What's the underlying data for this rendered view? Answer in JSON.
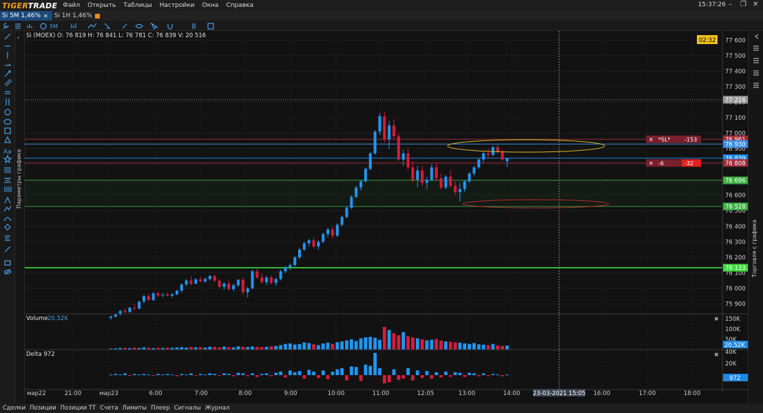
{
  "app": {
    "logo_a": "TIGER",
    "logo_b": "TRADE",
    "clock": "15:37:26"
  },
  "menu": [
    {
      "label": "Файл"
    },
    {
      "label": "Открыть"
    },
    {
      "label": "Таблицы"
    },
    {
      "label": "Настройки"
    },
    {
      "label": "Окна"
    },
    {
      "label": "Справка"
    }
  ],
  "tabs": [
    {
      "label": "Si 5M  1,46%",
      "active": true,
      "color": "#3a8ee6"
    },
    {
      "label": "Si 1H  1,46%",
      "active": false,
      "color": "#f08a20"
    }
  ],
  "toolbar": {
    "timeframe": "5M"
  },
  "sidebars": {
    "left": "Параметры графика",
    "right": "Торговля с графика"
  },
  "bottom_tabs": [
    {
      "label": "Сделки"
    },
    {
      "label": "Позиции"
    },
    {
      "label": "Позиции ТТ"
    },
    {
      "label": "Счета"
    },
    {
      "label": "Лимиты"
    },
    {
      "label": "Плеер"
    },
    {
      "label": "Сигналы"
    },
    {
      "label": "Журнал"
    }
  ],
  "chart_data": [
    {
      "type": "candlestick",
      "instrument_line": "Si (MOEX) O: 76 819  H: 76 841  L: 76 781  C: 76 839  V: 20 516",
      "timer": "02:32",
      "y_ticks": [
        "77 600",
        "77 500",
        "77 400",
        "77 300",
        "77 200",
        "77 100",
        "77 000",
        "76 900",
        "76 800",
        "76 700",
        "76 600",
        "76 500",
        "76 400",
        "76 300",
        "76 200",
        "76 100",
        "76 000",
        "75 900"
      ],
      "y_range": [
        75840,
        77650
      ],
      "levels": [
        {
          "label": "77 216",
          "value": 77216,
          "color": "#9a9a9a",
          "style": "dotted"
        },
        {
          "label": "76 961",
          "value": 76961,
          "color": "#a02a3a",
          "style": "solid"
        },
        {
          "label": "76 930",
          "value": 76930,
          "color": "#3a8ee6",
          "style": "solid"
        },
        {
          "label": "76 839",
          "value": 76839,
          "color": "#1e88e5",
          "style": "solid"
        },
        {
          "label": "76 808",
          "value": 76808,
          "color": "#a02a3a",
          "style": "solid"
        },
        {
          "label": "76 696",
          "value": 76696,
          "color": "#3cb043",
          "style": "solid"
        },
        {
          "label": "76 528",
          "value": 76528,
          "color": "#3cb043",
          "style": "solid"
        },
        {
          "label": "76 133",
          "value": 76133,
          "color": "#3cdc3c",
          "style": "solid"
        }
      ],
      "orders": [
        {
          "label": "*SL*",
          "qty": "-153",
          "value": 76961
        },
        {
          "label": "-6",
          "qty": "-32",
          "value": 76808
        }
      ],
      "x_ticks": [
        "мар22",
        "21:00",
        "мар23",
        "6:00",
        "7:00",
        "8:00",
        "9:00",
        "10:00",
        "11:00",
        "12:05",
        "13:00",
        "14:00",
        "23-03-2021 15:05",
        "16:00",
        "17:00",
        "18:00"
      ],
      "candles": [
        [
          75810,
          75825,
          75795,
          75818
        ],
        [
          75818,
          75840,
          75810,
          75832
        ],
        [
          75832,
          75860,
          75825,
          75855
        ],
        [
          75855,
          75870,
          75840,
          75848
        ],
        [
          75848,
          75880,
          75842,
          75875
        ],
        [
          75875,
          75900,
          75860,
          75870
        ],
        [
          75870,
          75920,
          75865,
          75915
        ],
        [
          75915,
          75960,
          75905,
          75950
        ],
        [
          75950,
          75965,
          75920,
          75925
        ],
        [
          75925,
          75975,
          75918,
          75968
        ],
        [
          75968,
          75980,
          75945,
          75955
        ],
        [
          75955,
          75970,
          75940,
          75960
        ],
        [
          75960,
          75975,
          75948,
          75952
        ],
        [
          75952,
          75970,
          75940,
          75962
        ],
        [
          75962,
          75990,
          75955,
          75985
        ],
        [
          75985,
          76030,
          75975,
          76025
        ],
        [
          76025,
          76060,
          76015,
          76050
        ],
        [
          76050,
          76080,
          76020,
          76030
        ],
        [
          76030,
          76065,
          76025,
          76058
        ],
        [
          76058,
          76075,
          76040,
          76045
        ],
        [
          76045,
          76070,
          76035,
          76060
        ],
        [
          76060,
          76085,
          76050,
          76080
        ],
        [
          76080,
          76090,
          76040,
          76050
        ],
        [
          76050,
          76060,
          76000,
          76010
        ],
        [
          76010,
          76040,
          75990,
          76030
        ],
        [
          76030,
          76050,
          75985,
          75995
        ],
        [
          75995,
          76030,
          75980,
          76020
        ],
        [
          76020,
          76060,
          76010,
          76055
        ],
        [
          76055,
          76070,
          75960,
          75975
        ],
        [
          75975,
          76010,
          75940,
          76000
        ],
        [
          76000,
          76120,
          75995,
          76110
        ],
        [
          76110,
          76125,
          76060,
          76070
        ],
        [
          76070,
          76095,
          76030,
          76040
        ],
        [
          76040,
          76080,
          76020,
          76070
        ],
        [
          76070,
          76085,
          76025,
          76035
        ],
        [
          76035,
          76070,
          76015,
          76060
        ],
        [
          76060,
          76120,
          76050,
          76110
        ],
        [
          76110,
          76145,
          76100,
          76135
        ],
        [
          76135,
          76160,
          76120,
          76150
        ],
        [
          76150,
          76210,
          76140,
          76200
        ],
        [
          76200,
          76260,
          76190,
          76250
        ],
        [
          76250,
          76300,
          76240,
          76290
        ],
        [
          76290,
          76320,
          76270,
          76310
        ],
        [
          76310,
          76330,
          76260,
          76270
        ],
        [
          76270,
          76310,
          76250,
          76300
        ],
        [
          76300,
          76360,
          76290,
          76350
        ],
        [
          76350,
          76390,
          76330,
          76380
        ],
        [
          76380,
          76400,
          76320,
          76340
        ],
        [
          76340,
          76420,
          76330,
          76410
        ],
        [
          76410,
          76470,
          76400,
          76460
        ],
        [
          76460,
          76530,
          76450,
          76520
        ],
        [
          76520,
          76600,
          76510,
          76590
        ],
        [
          76590,
          76660,
          76580,
          76650
        ],
        [
          76650,
          76700,
          76630,
          76690
        ],
        [
          76690,
          76780,
          76680,
          76770
        ],
        [
          76770,
          76880,
          76760,
          76870
        ],
        [
          76870,
          77020,
          76860,
          77010
        ],
        [
          77010,
          77130,
          76990,
          77110
        ],
        [
          77110,
          77140,
          76940,
          76960
        ],
        [
          76960,
          77080,
          76900,
          77050
        ],
        [
          77050,
          77090,
          76960,
          76980
        ],
        [
          76980,
          77000,
          76820,
          76830
        ],
        [
          76830,
          76890,
          76790,
          76870
        ],
        [
          76870,
          76900,
          76760,
          76780
        ],
        [
          76780,
          76820,
          76680,
          76700
        ],
        [
          76700,
          76790,
          76650,
          76760
        ],
        [
          76760,
          76790,
          76660,
          76680
        ],
        [
          76680,
          76720,
          76640,
          76700
        ],
        [
          76700,
          76800,
          76690,
          76780
        ],
        [
          76780,
          76810,
          76690,
          76710
        ],
        [
          76710,
          76740,
          76640,
          76650
        ],
        [
          76650,
          76730,
          76640,
          76720
        ],
        [
          76720,
          76760,
          76650,
          76660
        ],
        [
          76660,
          76690,
          76600,
          76620
        ],
        [
          76620,
          76680,
          76560,
          76640
        ],
        [
          76640,
          76700,
          76620,
          76690
        ],
        [
          76690,
          76750,
          76680,
          76740
        ],
        [
          76740,
          76790,
          76720,
          76780
        ],
        [
          76780,
          76840,
          76770,
          76830
        ],
        [
          76830,
          76880,
          76810,
          76870
        ],
        [
          76870,
          76900,
          76840,
          76860
        ],
        [
          76860,
          76920,
          76850,
          76910
        ],
        [
          76910,
          76930,
          76870,
          76880
        ],
        [
          76880,
          76895,
          76820,
          76830
        ],
        [
          76819,
          76841,
          76781,
          76839
        ]
      ]
    },
    {
      "type": "bar",
      "name": "Volume",
      "value_label": "20,52K",
      "y_ticks": [
        "150K",
        "100K",
        "50K"
      ],
      "current": "20,52K",
      "values": [
        5,
        6,
        8,
        9,
        7,
        10,
        8,
        11,
        9,
        7,
        9,
        8,
        10,
        9,
        11,
        12,
        10,
        13,
        11,
        12,
        10,
        14,
        13,
        11,
        15,
        12,
        11,
        16,
        14,
        13,
        15,
        13,
        12,
        14,
        16,
        18,
        22,
        28,
        30,
        25,
        27,
        35,
        32,
        26,
        22,
        30,
        34,
        28,
        36,
        40,
        45,
        50,
        42,
        55,
        60,
        62,
        58,
        48,
        110,
        95,
        80,
        70,
        85,
        65,
        60,
        55,
        50,
        45,
        48,
        52,
        44,
        40,
        38,
        36,
        34,
        30,
        28,
        32,
        26,
        24,
        22,
        28,
        20,
        18,
        20
      ]
    },
    {
      "type": "bar",
      "name": "Delta",
      "value_label": "972",
      "y_ticks": [
        "40K",
        "20K"
      ],
      "current": "972",
      "values": [
        1,
        2,
        1,
        3,
        -1,
        2,
        1,
        2,
        1,
        -1,
        2,
        1,
        2,
        1,
        -2,
        2,
        1,
        3,
        -1,
        2,
        1,
        3,
        2,
        -1,
        3,
        2,
        -2,
        4,
        3,
        -2,
        3,
        -3,
        2,
        3,
        -2,
        4,
        6,
        -4,
        8,
        5,
        7,
        -6,
        9,
        6,
        -5,
        8,
        -7,
        6,
        10,
        12,
        -9,
        15,
        14,
        -10,
        18,
        16,
        38,
        12,
        -14,
        -12,
        10,
        -8,
        -6,
        12,
        -9,
        8,
        -5,
        7,
        -6,
        5,
        -4,
        6,
        -3,
        5,
        4,
        -3,
        4,
        3,
        -2,
        3,
        -2,
        2,
        1,
        -2,
        1
      ]
    }
  ]
}
